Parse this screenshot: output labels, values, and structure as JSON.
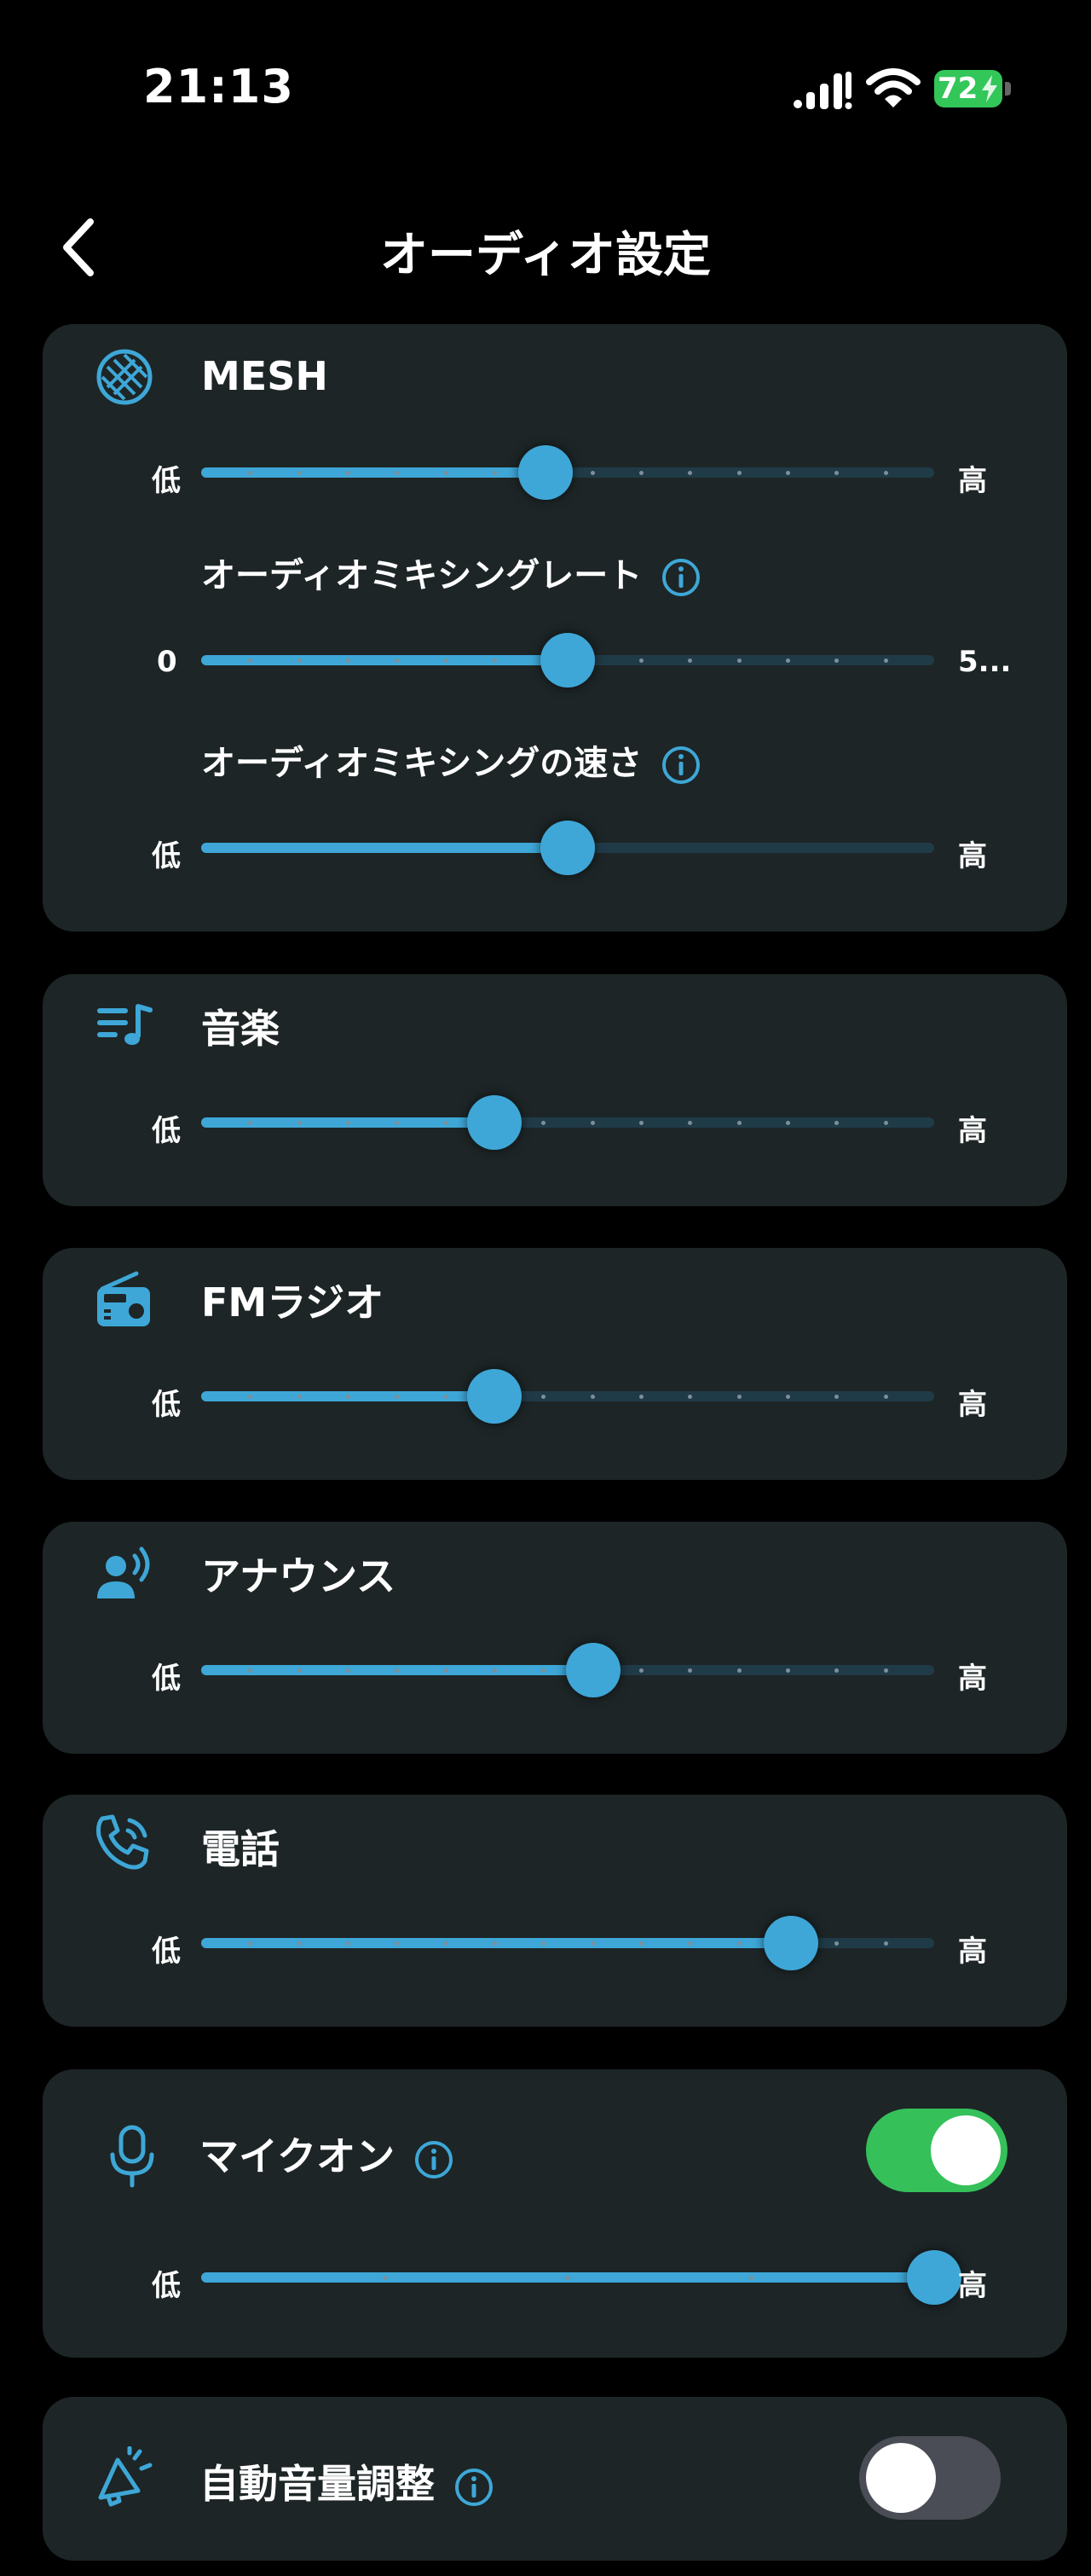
{
  "status_bar": {
    "time": "21:13",
    "battery": "72"
  },
  "header": {
    "title": "オーディオ設定"
  },
  "icons": {
    "back": "chevron-left-icon",
    "mesh": "mesh-icon",
    "music": "music-queue-icon",
    "radio": "radio-icon",
    "announce": "speaker-person-icon",
    "phone": "phone-ringing-icon",
    "mic": "microphone-icon",
    "auto_volume": "megaphone-icon",
    "info": "info-icon"
  },
  "colors": {
    "accent": "#3ea7d7",
    "card": "#1d2526",
    "toggle_on": "#35c05a",
    "toggle_off": "#4a4d55"
  },
  "mesh": {
    "label": "MESH",
    "volume": {
      "min_label": "低",
      "max_label": "高",
      "value": 0.47
    },
    "mixing_rate": {
      "label": "オーディオミキシングレート",
      "min_label": "0",
      "max_label": "5...",
      "value": 0.5
    },
    "mixing_speed": {
      "label": "オーディオミキシングの速さ",
      "min_label": "低",
      "max_label": "高",
      "value": 0.5
    }
  },
  "music": {
    "label": "音楽",
    "min_label": "低",
    "max_label": "高",
    "value": 0.4
  },
  "fm": {
    "label": "FMラジオ",
    "min_label": "低",
    "max_label": "高",
    "value": 0.4
  },
  "announce": {
    "label": "アナウンス",
    "min_label": "低",
    "max_label": "高",
    "value": 0.535
  },
  "phone": {
    "label": "電話",
    "min_label": "低",
    "max_label": "高",
    "value": 0.805
  },
  "mic": {
    "label": "マイクオン",
    "toggle_on": true,
    "min_label": "低",
    "max_label": "高",
    "value": 1.0
  },
  "auto_volume": {
    "label": "自動音量調整",
    "toggle_on": false
  }
}
